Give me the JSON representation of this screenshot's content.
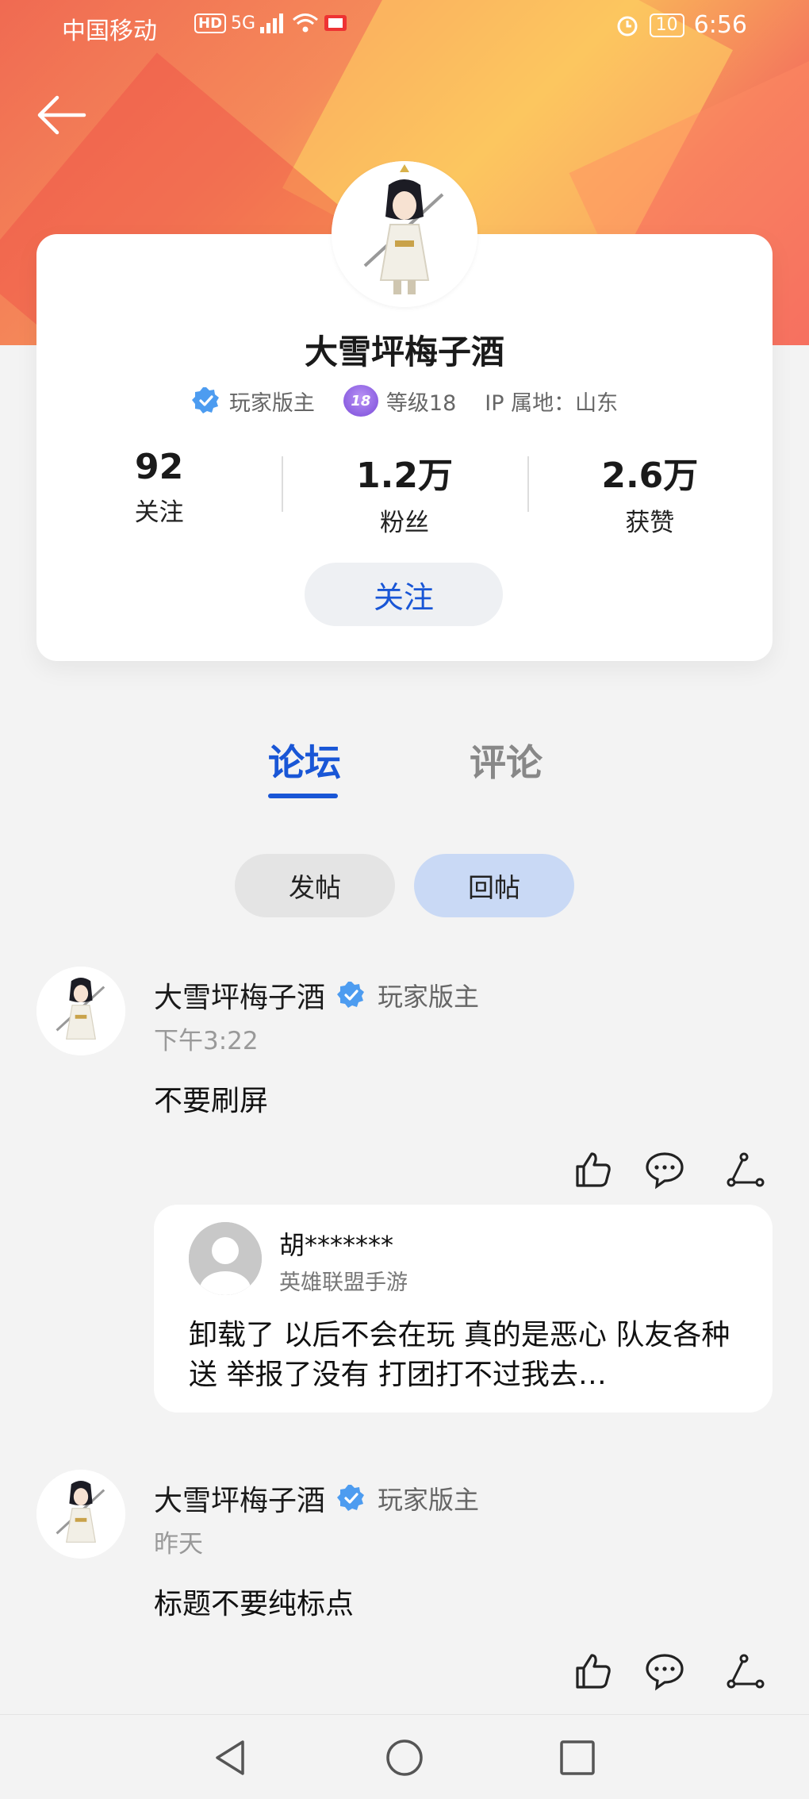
{
  "status_bar": {
    "carrier": "中国移动",
    "hd": "HD",
    "network": "5G",
    "battery": "10",
    "time": "6:56"
  },
  "profile": {
    "username": "大雪坪梅子酒",
    "role": "玩家版主",
    "level_badge": "18",
    "level": "等级18",
    "ip_location": "IP 属地：山东",
    "stats": [
      {
        "value": "92",
        "label": "关注"
      },
      {
        "value": "1.2万",
        "label": "粉丝"
      },
      {
        "value": "2.6万",
        "label": "获赞"
      }
    ],
    "follow_label": "关注"
  },
  "tabs": {
    "forum": "论坛",
    "comments": "评论"
  },
  "subtabs": {
    "posts": "发帖",
    "replies": "回帖"
  },
  "posts": [
    {
      "author": "大雪坪梅子酒",
      "role": "玩家版主",
      "time": "下午3:22",
      "content": "不要刷屏",
      "quote": {
        "author": "胡*******",
        "source": "英雄联盟手游",
        "text": "卸载了 以后不会在玩 真的是恶心 队友各种送  举报了没有  打团打不过我去…"
      }
    },
    {
      "author": "大雪坪梅子酒",
      "role": "玩家版主",
      "time": "昨天",
      "content": "标题不要纯标点"
    }
  ],
  "colors": {
    "accent": "#1956d6",
    "verified": "#4d9cf0"
  },
  "icons": [
    "back-arrow-icon",
    "verified-icon",
    "level-icon",
    "like-icon",
    "comment-icon",
    "share-icon",
    "nav-back-icon",
    "nav-home-icon",
    "nav-recents-icon"
  ]
}
